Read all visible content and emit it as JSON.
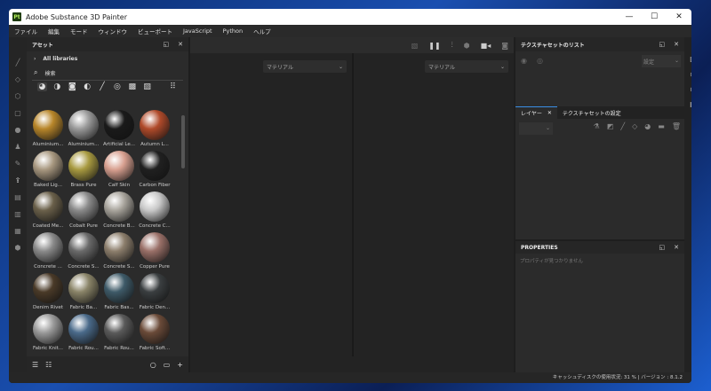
{
  "window": {
    "title": "Adobe Substance 3D Painter",
    "logo": "Pt",
    "minimize": "—",
    "maximize": "☐",
    "close": "✕"
  },
  "menu": [
    "ファイル",
    "編集",
    "モード",
    "ウィンドウ",
    "ビューポート",
    "JavaScript",
    "Python",
    "ヘルプ"
  ],
  "assets": {
    "title": "アセット",
    "library": "All libraries",
    "search_placeholder": "検索",
    "items": [
      {
        "label": "Aluminium...",
        "color": "#b8862a"
      },
      {
        "label": "Aluminium...",
        "color": "#9a9a9a"
      },
      {
        "label": "Artificial Le...",
        "color": "#1a1a1a"
      },
      {
        "label": "Autumn L...",
        "color": "#b04a2a"
      },
      {
        "label": "Baked Lig...",
        "color": "#a89880"
      },
      {
        "label": "Brass Pure",
        "color": "#a89a40"
      },
      {
        "label": "Calf Skin",
        "color": "#d8a090"
      },
      {
        "label": "Carbon Fiber",
        "color": "#202020"
      },
      {
        "label": "Coated Me...",
        "color": "#6a604a"
      },
      {
        "label": "Cobalt Pure",
        "color": "#8a8a8a"
      },
      {
        "label": "Concrete B...",
        "color": "#a8a49c"
      },
      {
        "label": "Concrete C...",
        "color": "#c8c8c8"
      },
      {
        "label": "Concrete ...",
        "color": "#8a8a8a"
      },
      {
        "label": "Concrete S...",
        "color": "#6a6a6a"
      },
      {
        "label": "Concrete S...",
        "color": "#8c7e6c"
      },
      {
        "label": "Copper Pure",
        "color": "#9a7068"
      },
      {
        "label": "Denim Rivet",
        "color": "#4a3a28"
      },
      {
        "label": "Fabric Ba...",
        "color": "#8a8468"
      },
      {
        "label": "Fabric Bas...",
        "color": "#3e5a68"
      },
      {
        "label": "Fabric Den...",
        "color": "#3a3e40"
      },
      {
        "label": "Fabric Knit...",
        "color": "#9a9a9a"
      },
      {
        "label": "Fabric Rou...",
        "color": "#4a6a8a"
      },
      {
        "label": "Fabric Rou...",
        "color": "#5a5a5a"
      },
      {
        "label": "Fabric Soft...",
        "color": "#6a4a38"
      }
    ]
  },
  "viewport": {
    "left_channel": "マテリアル",
    "right_channel": "マテリアル"
  },
  "texture_set_list": {
    "title": "テクスチャセットのリスト",
    "settings": "設定"
  },
  "layers": {
    "tab_layers": "レイヤー",
    "tab_texture_settings": "テクスチャセットの設定"
  },
  "properties": {
    "title": "PROPERTIES",
    "empty": "プロパティが見つかりません"
  },
  "status": {
    "text": "キャッシュディスクの使用状況:  31 % | バージョン : 8.1.2"
  }
}
